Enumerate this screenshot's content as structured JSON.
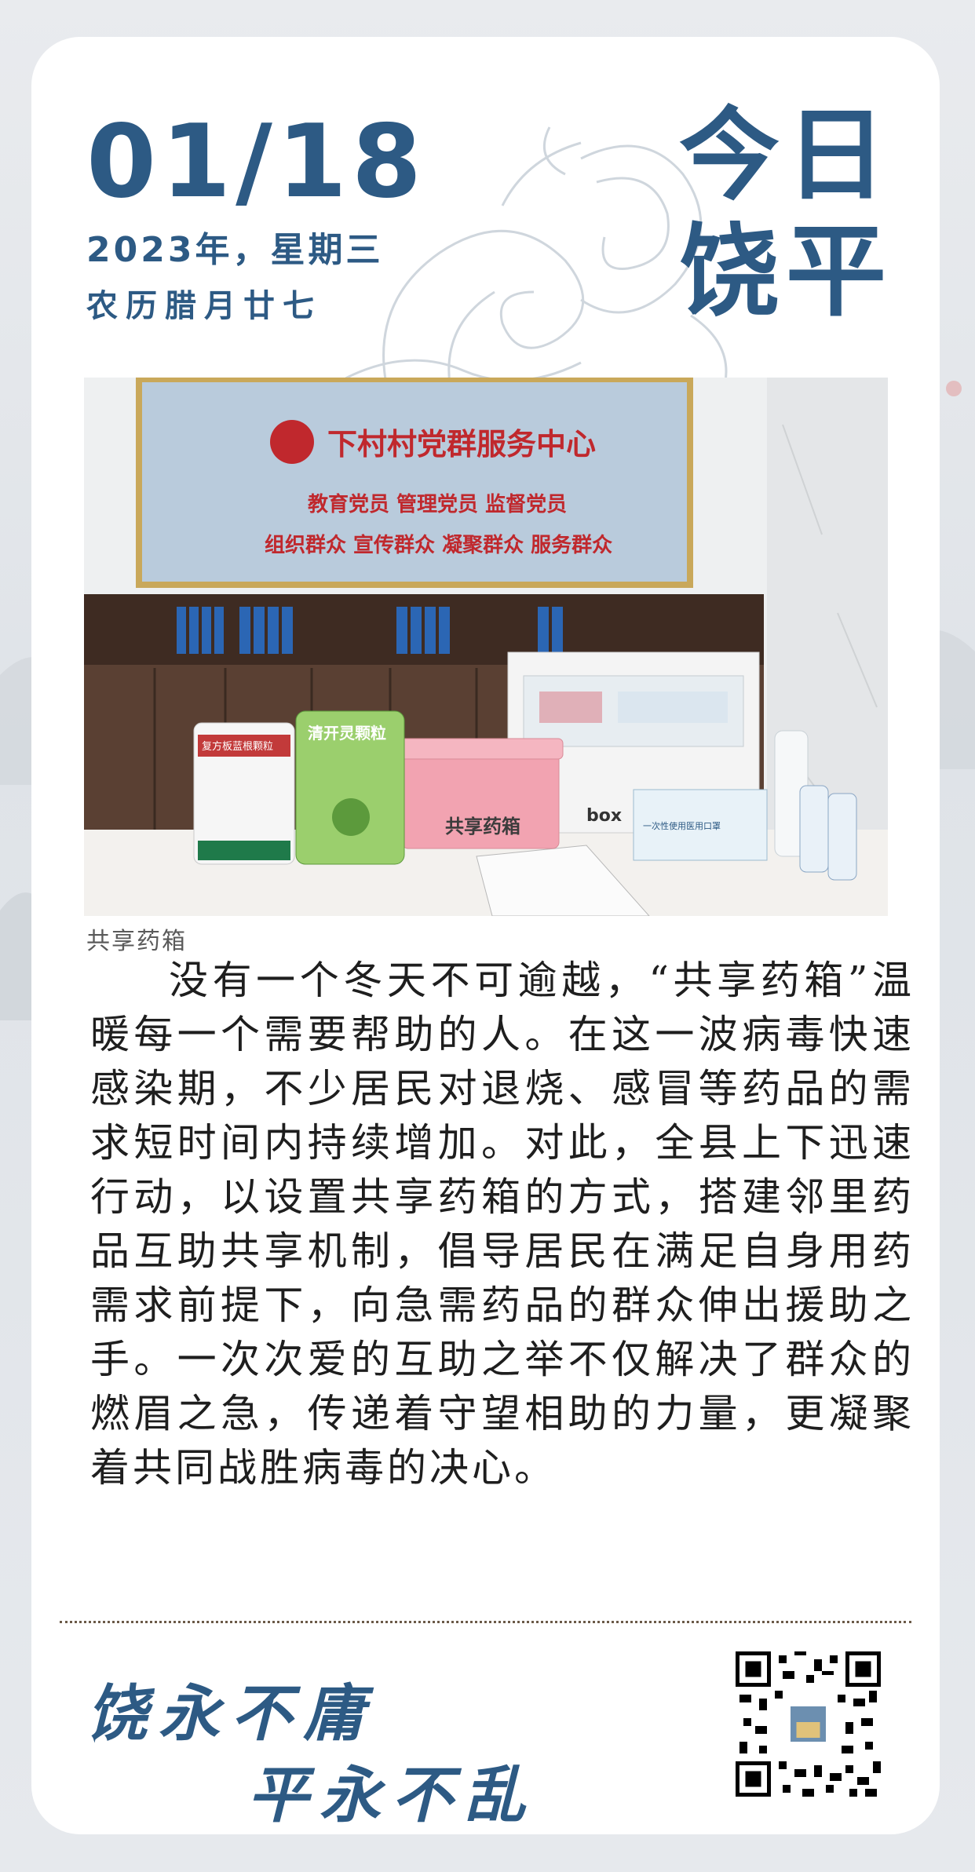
{
  "header": {
    "date": "01/18",
    "date_line": "2023年，星期三",
    "lunar_line": "农历腊月廿七",
    "brand": "今日饶平"
  },
  "photo": {
    "board_title": "下村村党群服务中心",
    "board_line1": "教育党员 管理党员 监督党员",
    "board_line2": "组织群众 宣传群众 凝聚群众 服务群众",
    "box_label": "共享药箱",
    "bag_left": "复方板蓝根颗粒",
    "bag_right": "清开灵颗粒",
    "mask_box": "一次性使用医用口罩",
    "cart_label": "box"
  },
  "caption": "共享药箱",
  "article": "没有一个冬天不可逾越，“共享药箱”温暖每一个需要帮助的人。在这一波病毒快速感染期，不少居民对退烧、感冒等药品的需求短时间内持续增加。对此，全县上下迅速行动，以设置共享药箱的方式，搭建邻里药品互助共享机制，倡导居民在满足自身用药需求前提下，向急需药品的群众伸出援助之手。一次次爱的互助之举不仅解决了群众的燃眉之急，传递着守望相助的力量，更凝聚着共同战胜病毒的决心。",
  "footer": {
    "motto_line1": "饶永不庸",
    "motto_line2": "平永不乱"
  },
  "colors": {
    "brand_blue": "#2d5a84",
    "body_text": "#1e1e1e"
  }
}
